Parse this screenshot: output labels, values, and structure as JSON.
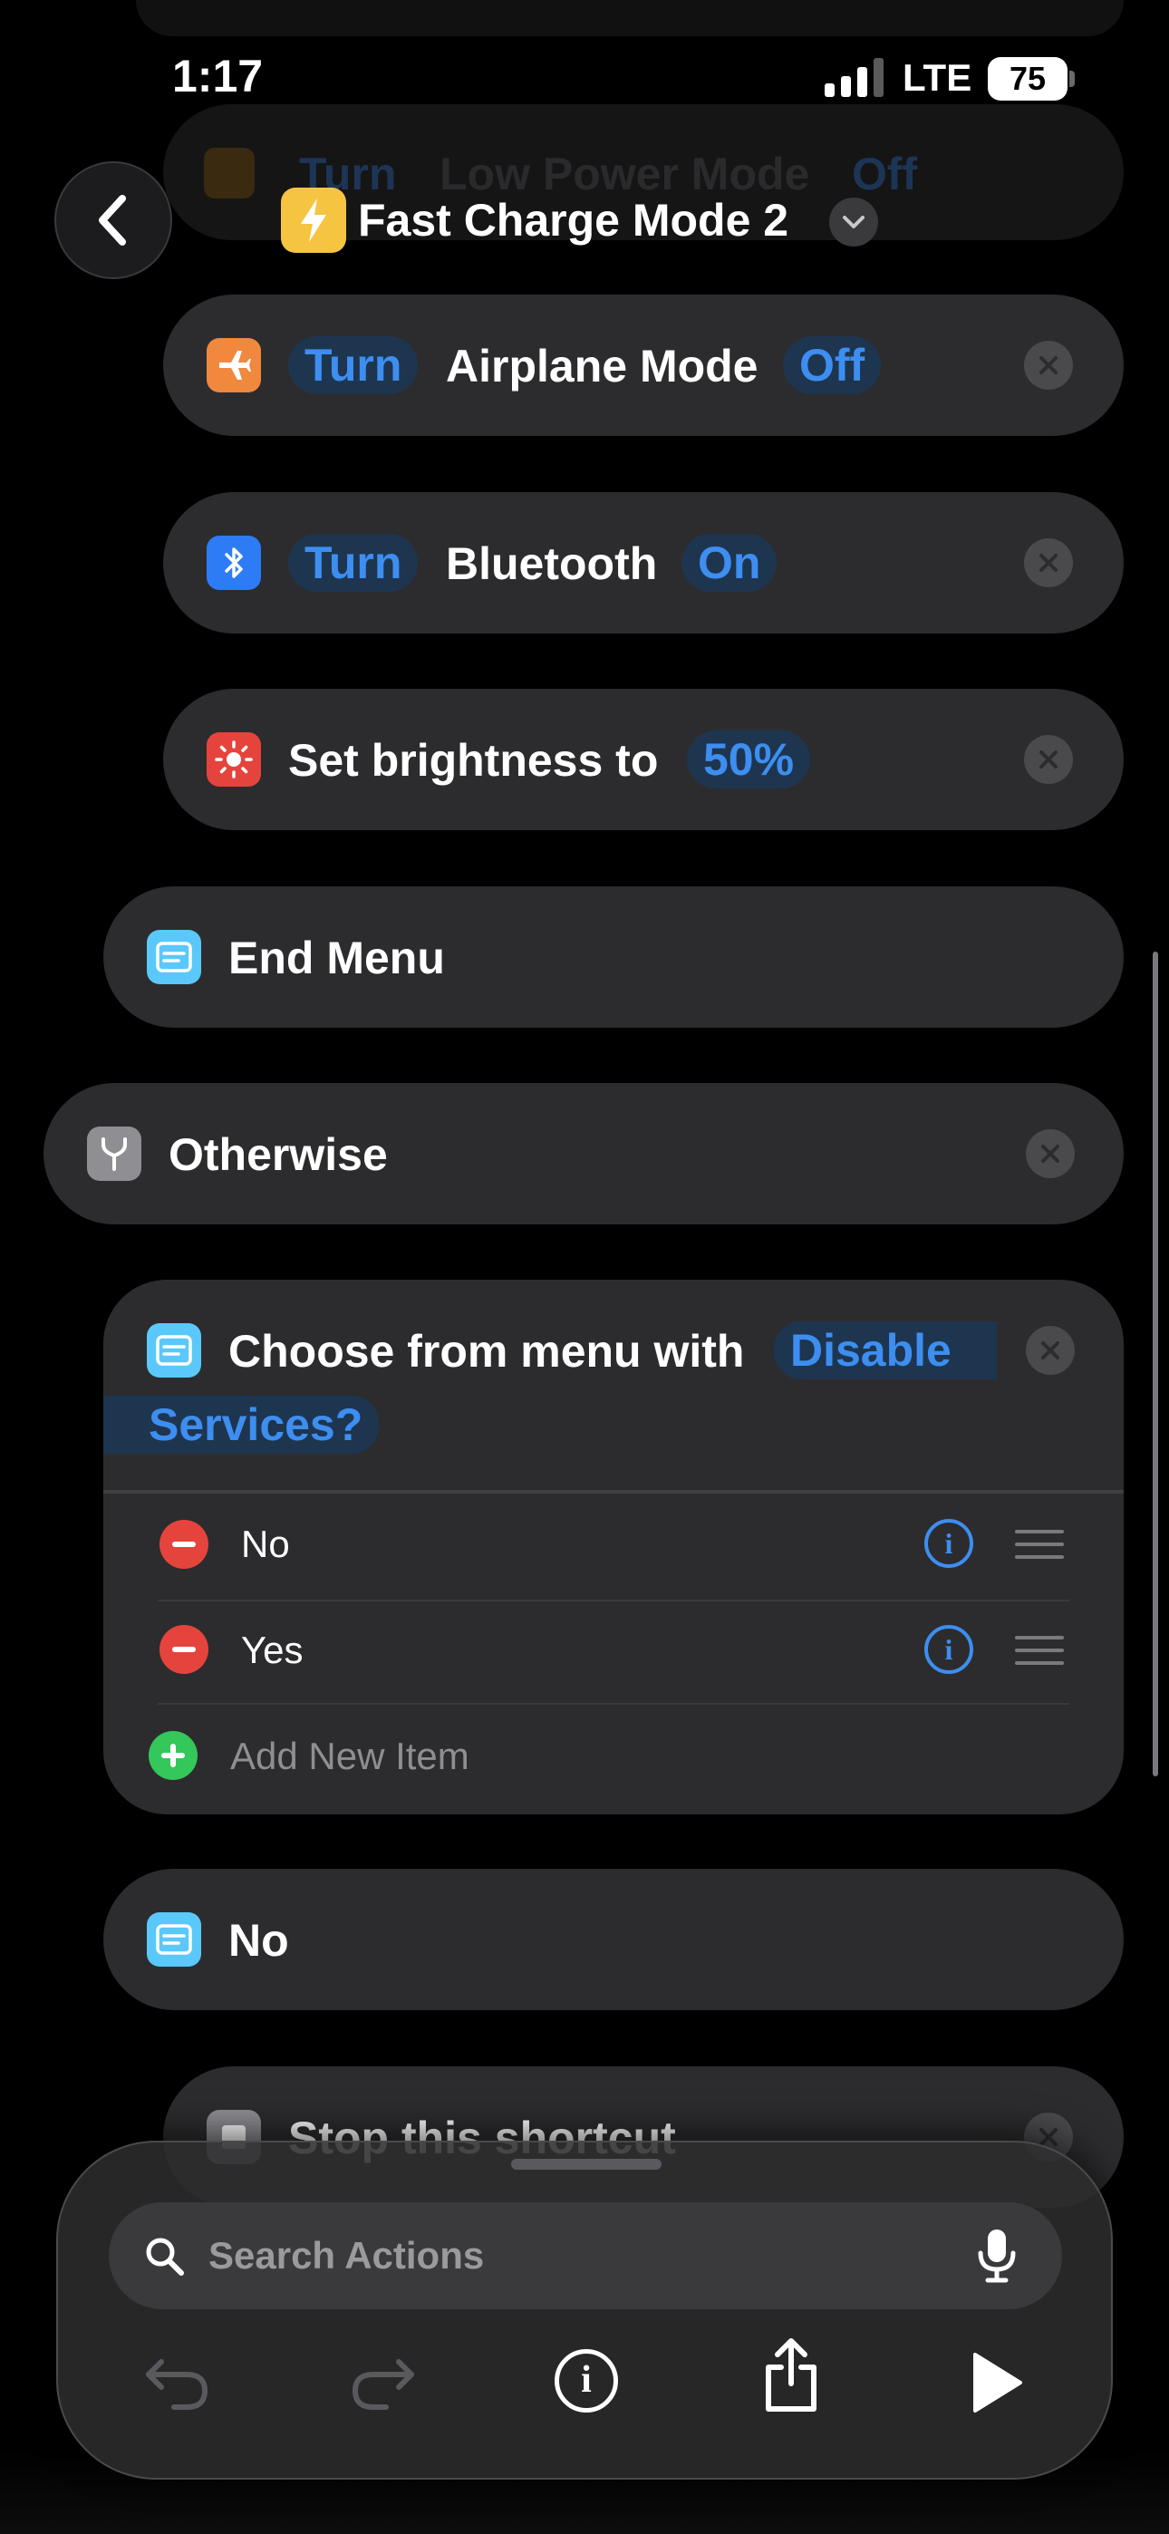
{
  "status_bar": {
    "time": "1:17",
    "network": "LTE",
    "battery": "75"
  },
  "header": {
    "title": "Fast Charge Mode 2"
  },
  "faded_top_action": {
    "verb": "Turn",
    "label": "Low Power Mode",
    "value": "Off"
  },
  "actions": {
    "airplane": {
      "verb": "Turn",
      "label": "Airplane Mode",
      "value": "Off"
    },
    "bluetooth": {
      "verb": "Turn",
      "label": "Bluetooth",
      "value": "On"
    },
    "brightness": {
      "label": "Set brightness to",
      "value": "50%"
    },
    "end_menu": {
      "label": "End Menu"
    },
    "otherwise": {
      "label": "Otherwise"
    },
    "choose_menu": {
      "label": "Choose from menu with",
      "prompt_line1": "Disable",
      "prompt_line2": "Services?",
      "items": [
        {
          "label": "No"
        },
        {
          "label": "Yes"
        }
      ],
      "add_item_label": "Add New Item"
    },
    "no_case": {
      "label": "No"
    },
    "stop": {
      "label": "Stop this shortcut"
    }
  },
  "bottom_panel": {
    "search_placeholder": "Search Actions"
  },
  "colors": {
    "accent": "#3d8ef0",
    "card": "#2c2c2e",
    "airplane": "#f0883e",
    "bluetooth": "#2d7cf6",
    "brightness": "#e5443d",
    "menu": "#5ac8fa",
    "yellow": "#f5c542"
  }
}
